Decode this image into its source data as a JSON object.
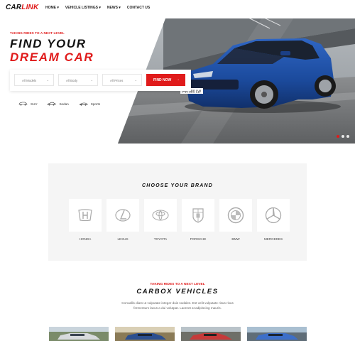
{
  "header": {
    "logo_part1": "CAR",
    "logo_part2": "LINK",
    "nav": [
      "HOME ▾",
      "VEHICLE LISTINGS ▾",
      "NEWS ▾",
      "CONTACT US"
    ]
  },
  "hero": {
    "tagline": "TAKING RIDES TO A NEXT LEVEL",
    "title_line1": "FIND YOUR",
    "title_line2": "DREAM CAR",
    "plate": "FW 080 LW",
    "filters": {
      "models": "All Models",
      "body": "All Body",
      "prices": "All Prices",
      "button": "FIND NOW"
    },
    "types": [
      {
        "icon": "car-suv-icon",
        "label": "SUV"
      },
      {
        "icon": "car-sedan-icon",
        "label": "Sedan"
      },
      {
        "icon": "car-sports-icon",
        "label": "Sports"
      }
    ],
    "slides": 3,
    "active_slide": 1
  },
  "brands": {
    "title": "CHOOSE YOUR BRAND",
    "items": [
      {
        "name": "HONDA",
        "icon": "honda-logo-icon"
      },
      {
        "name": "LEXUS",
        "icon": "lexus-logo-icon"
      },
      {
        "name": "TOYOTA",
        "icon": "toyota-logo-icon"
      },
      {
        "name": "PORSCHE",
        "icon": "porsche-logo-icon"
      },
      {
        "name": "BMW",
        "icon": "bmw-logo-icon"
      },
      {
        "name": "MERCEDES",
        "icon": "mercedes-logo-icon"
      }
    ]
  },
  "vehicles": {
    "tagline": "TAKING RIDES TO A NEXT LEVEL",
    "title": "CARBOX VEHICLES",
    "description": "Convallis diam ut vulputate integer duis sodales. Est velit vulputate risus risus fermentum lacus a dui volutpat. Laoreet at adipiscing mauris."
  },
  "colors": {
    "accent": "#e01b1b",
    "car_body": "#1d4fa0",
    "brand_panel": "#f5f5f5"
  }
}
